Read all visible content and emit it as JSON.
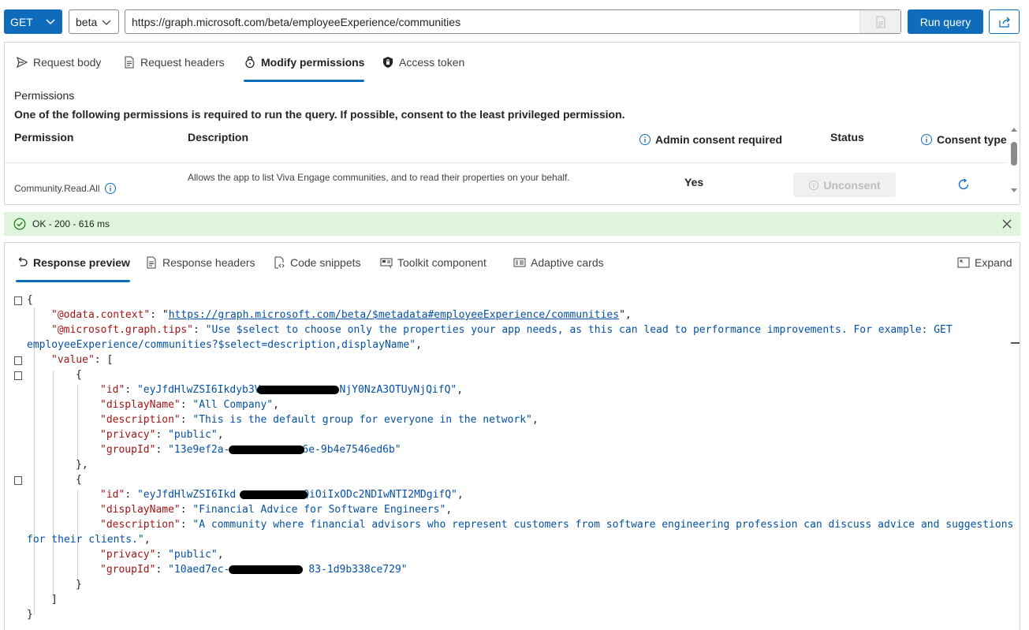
{
  "toolbar": {
    "method": "GET",
    "version": "beta",
    "url": "https://graph.microsoft.com/beta/employeeExperience/communities",
    "run_label": "Run query"
  },
  "request_tabs": [
    {
      "label": "Request body",
      "icon": "send-icon"
    },
    {
      "label": "Request headers",
      "icon": "document-icon"
    },
    {
      "label": "Modify permissions",
      "icon": "lock-icon",
      "active": true
    },
    {
      "label": "Access token",
      "icon": "shield-lock-icon"
    }
  ],
  "permissions": {
    "title": "Permissions",
    "note": "One of the following permissions is required to run the query. If possible, consent to the least privileged permission.",
    "columns": {
      "permission": "Permission",
      "description": "Description",
      "admin": "Admin consent required",
      "status": "Status",
      "consent_type": "Consent type"
    },
    "rows": [
      {
        "permission": "Community.Read.All",
        "description": "Allows the app to list Viva Engage communities, and to read their properties on your behalf.",
        "admin": "Yes",
        "status_button": "Unconsent"
      }
    ]
  },
  "status": {
    "text": "OK - 200 - 616 ms",
    "color": "#dff6dd"
  },
  "response_tabs": [
    {
      "label": "Response preview",
      "icon": "undo-arrow-icon",
      "active": true
    },
    {
      "label": "Response headers",
      "icon": "document-icon"
    },
    {
      "label": "Code snippets",
      "icon": "code-file-icon"
    },
    {
      "label": "Toolkit component",
      "icon": "component-icon"
    },
    {
      "label": "Adaptive cards",
      "icon": "card-icon"
    }
  ],
  "expand_label": "Expand",
  "response_json": {
    "odata_context_key": "\"@odata.context\"",
    "odata_context_value": "https://graph.microsoft.com/beta/$metadata#employeeExperience/communities",
    "tips_key": "\"@microsoft.graph.tips\"",
    "tips_value_line1": "\"Use $select to choose only the properties your app needs, as this can lead to performance improvements. For example: GET",
    "tips_value_line2": "employeeExperience/communities?$select=description,displayName\"",
    "value_key": "\"value\"",
    "items": [
      {
        "id_start": "\"eyJfdHlwZSI6Ikdyb3V",
        "id_end": "NjY0NzA3OTUyNjQifQ\"",
        "displayName": "\"All Company\"",
        "description": "\"This is the default group for everyone in the network\"",
        "privacy": "\"public\"",
        "groupId_start": "\"13e9ef2a-",
        "groupId_end": "6e-9b4e7546ed6b\""
      },
      {
        "id_start": "\"eyJfdHlwZSI6Ikd",
        "id_end": "QiOiIxODc2NDIwNTI2MDgifQ\"",
        "displayName": "\"Financial Advice for Software Engineers\"",
        "description_line1": "\"A community where financial advisors who represent customers from software engineering profession can discuss advice and suggestions",
        "description_line2": "for their clients.\"",
        "privacy": "\"public\"",
        "groupId_start": "\"10aed7ec-",
        "groupId_end": "83-1d9b338ce729\""
      }
    ],
    "keys": {
      "id": "\"id\"",
      "displayName": "\"displayName\"",
      "description": "\"description\"",
      "privacy": "\"privacy\"",
      "groupId": "\"groupId\""
    }
  },
  "colors": {
    "accent": "#0f6cbd",
    "json_key": "#a31515",
    "json_string": "#0451a5",
    "success": "#107c10"
  }
}
